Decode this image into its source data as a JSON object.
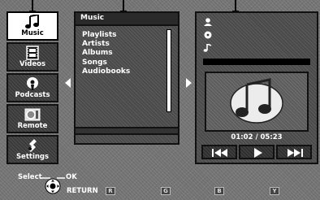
{
  "nav": {
    "items": [
      {
        "label": "Music",
        "icon": "music-note-icon",
        "active": true
      },
      {
        "label": "Videos",
        "icon": "film-icon",
        "active": false
      },
      {
        "label": "Podcasts",
        "icon": "podcast-icon",
        "active": false
      },
      {
        "label": "Remote",
        "icon": "remote-icon",
        "active": false
      },
      {
        "label": "Settings",
        "icon": "settings-icon",
        "active": false
      }
    ]
  },
  "list": {
    "title": "Music",
    "items": [
      "Playlists",
      "Artists",
      "Albums",
      "Songs",
      "Audiobooks"
    ]
  },
  "now_playing": {
    "meta_icons": [
      "artist-icon",
      "album-icon",
      "song-icon"
    ],
    "time": "01:02 / 05:23",
    "controls": [
      "previous-icon",
      "play-icon",
      "next-icon"
    ]
  },
  "hints": {
    "select": "Select",
    "ok": "OK",
    "return": "RETURN",
    "keys": [
      "R",
      "G",
      "B",
      "Y"
    ]
  }
}
